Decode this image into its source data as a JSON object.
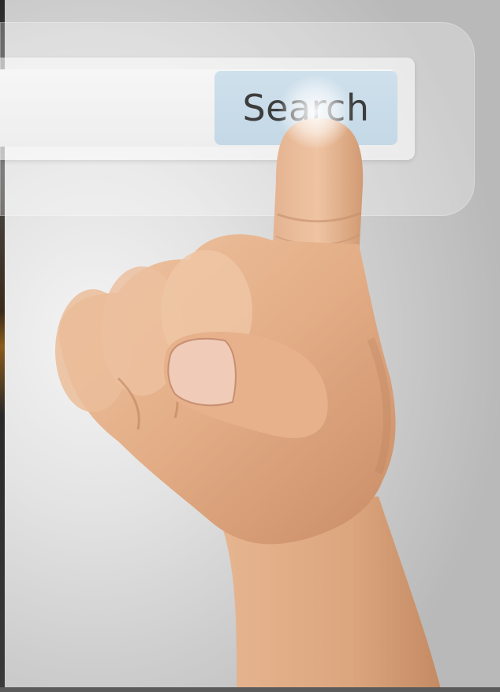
{
  "search": {
    "button_label": "Search",
    "input_value": ""
  },
  "colors": {
    "background": "#d9d9d9",
    "button_fill": "#c9dbe8",
    "button_text": "#3d3d3d",
    "skin": "#e8b690"
  }
}
